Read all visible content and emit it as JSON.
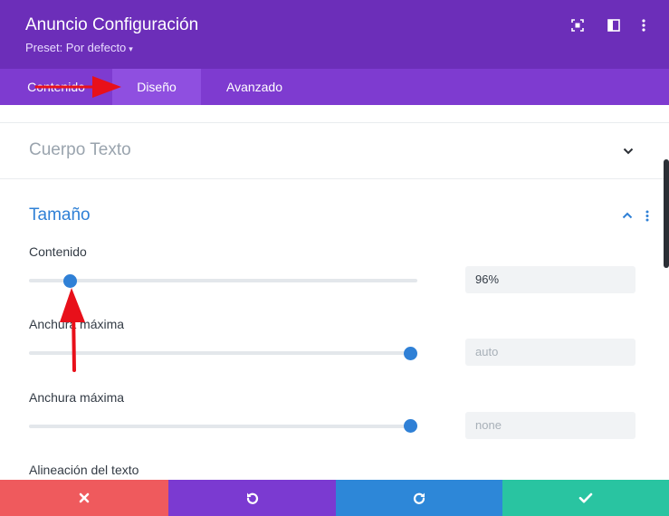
{
  "header": {
    "title": "Anuncio Configuración",
    "preset_label": "Preset: Por defecto",
    "icons": [
      "focus-icon",
      "sidebar-layout-icon",
      "more-vertical-icon"
    ]
  },
  "tabs": [
    {
      "label": "Contenido",
      "active": false
    },
    {
      "label": "Diseño",
      "active": true
    },
    {
      "label": "Avanzado",
      "active": false
    }
  ],
  "sections": {
    "cuerpo_texto": {
      "title": "Cuerpo Texto",
      "expanded": false
    },
    "tamano": {
      "title": "Tamaño",
      "expanded": true
    }
  },
  "fields": [
    {
      "label": "Contenido",
      "value": "96%",
      "value_is_placeholder": false,
      "slider_level": 0.1
    },
    {
      "label": "Anchura máxima",
      "value": "auto",
      "value_is_placeholder": true,
      "slider_level": 1.0
    },
    {
      "label": "Anchura máxima",
      "value": "none",
      "value_is_placeholder": true,
      "slider_level": 1.0
    }
  ],
  "truncated_field_label": "Alineación del texto",
  "footer": {
    "buttons": [
      {
        "name": "cancel-button",
        "icon": "close-icon",
        "color": "#ef5a5d"
      },
      {
        "name": "undo-button",
        "icon": "undo-icon",
        "color": "#7b3ad1"
      },
      {
        "name": "redo-button",
        "icon": "redo-icon",
        "color": "#2d87d8"
      },
      {
        "name": "save-button",
        "icon": "check-icon",
        "color": "#29c4a1"
      }
    ]
  },
  "colors": {
    "header_bg": "#6c2eb9",
    "tabs_bg": "#7e3bd0",
    "active_tab_bg": "#8f4fe0",
    "accent_blue": "#2f80d6",
    "annotation_red": "#e8101a"
  }
}
